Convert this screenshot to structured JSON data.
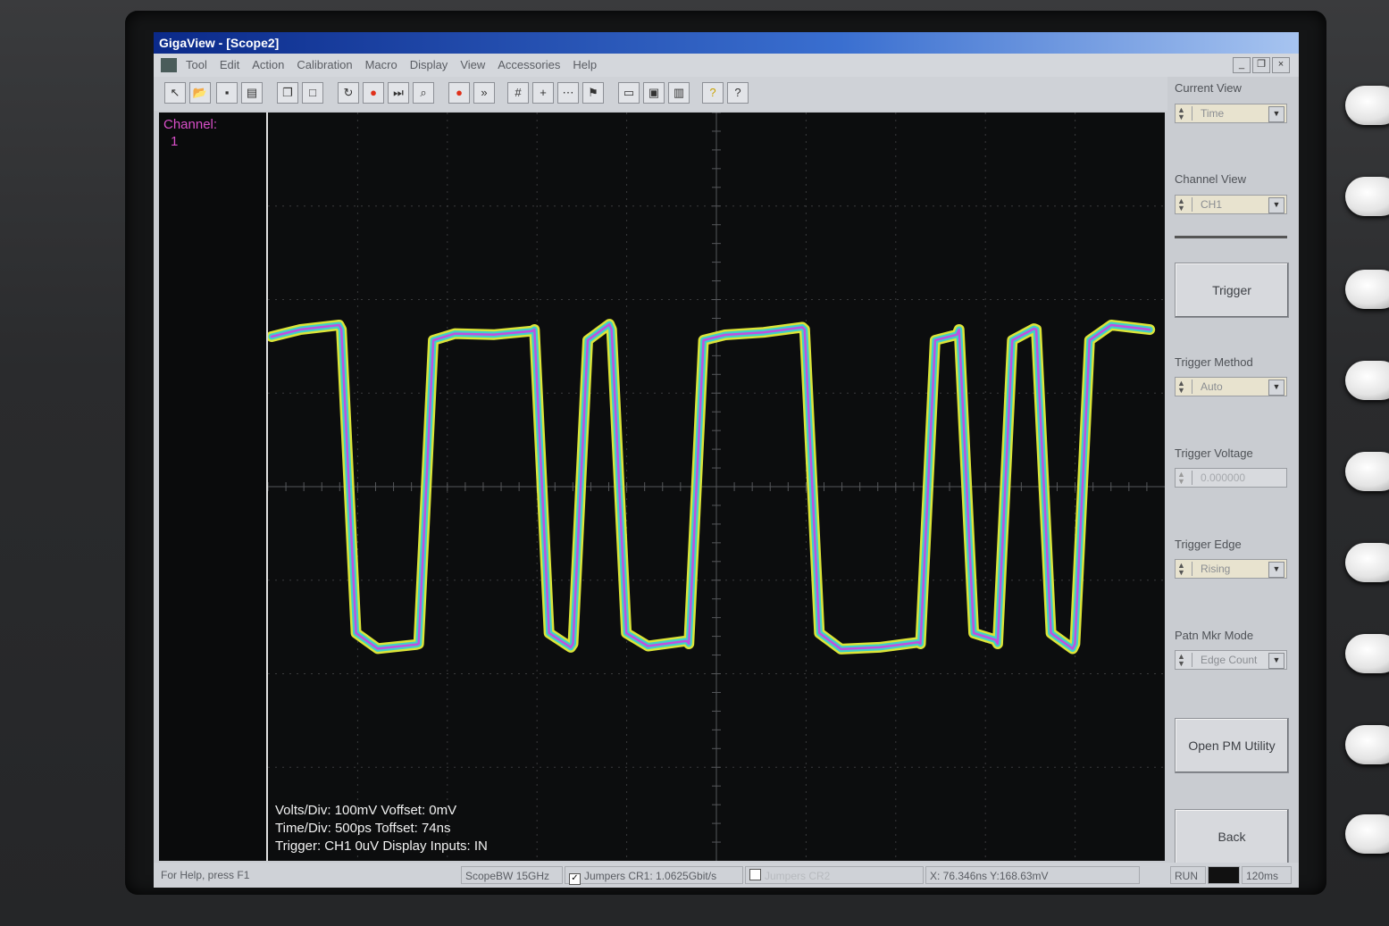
{
  "window": {
    "title": "GigaView - [Scope2]"
  },
  "menu": [
    "Tool",
    "Edit",
    "Action",
    "Calibration",
    "Macro",
    "Display",
    "View",
    "Accessories",
    "Help"
  ],
  "window_controls": [
    "_",
    "❐",
    "×"
  ],
  "toolbar_icons": [
    "pointer-icon",
    "open-icon",
    "save-icon",
    "print-icon",
    "copy-icon",
    "blank-icon",
    "cycle-icon",
    "stop-icon",
    "step-icon",
    "zoom-icon",
    "record-icon",
    "fast-forward-icon",
    "grid-icon",
    "crosshair-icon",
    "measure-icon",
    "marker-icon",
    "export-icon",
    "compare-icon",
    "report-icon",
    "help-icon",
    "context-help-icon"
  ],
  "left_panel": {
    "channel_label": "Channel:",
    "channel_number": "1"
  },
  "readout": {
    "line1": "Volts/Div: 100mV Voffset: 0mV",
    "line2": "Time/Div: 500ps Toffset: 74ns",
    "line3": "Trigger: CH1 0uV Display Inputs: IN"
  },
  "right_panel": {
    "current_view_label": "Current View",
    "current_view_value": "Time",
    "channel_view_label": "Channel View",
    "channel_view_value": "CH1",
    "trigger_button": "Trigger",
    "trigger_method_label": "Trigger Method",
    "trigger_method_value": "Auto",
    "trigger_voltage_label": "Trigger Voltage",
    "trigger_voltage_value": "0.000000",
    "trigger_edge_label": "Trigger Edge",
    "trigger_edge_value": "Rising",
    "patn_mkr_label": "Patn Mkr Mode",
    "patn_mkr_value": "Edge Count",
    "open_pm_button": "Open PM Utility",
    "back_button": "Back"
  },
  "statusbar": {
    "help": "For Help, press F1",
    "scope_bw": "ScopeBW 15GHz",
    "jumpers_cr1": "Jumpers CR1: 1.0625Gbit/s",
    "jumpers_cr2": "Jumpers CR2",
    "cursor": "X: 76.346ns Y:168.63mV",
    "run": "RUN",
    "time": "120ms"
  },
  "colors": {
    "trace_outer": "#e8f03a",
    "trace_mid": "#3fd0c8",
    "trace_inner": "#c24fe0",
    "channel_label": "#d94fc9"
  },
  "waveform": {
    "bits": [
      1,
      1,
      0,
      0,
      1,
      1,
      1,
      0,
      1,
      0,
      0,
      1,
      1,
      1,
      0,
      0,
      0,
      1,
      0,
      1,
      0,
      1,
      1
    ],
    "high_mV": 168,
    "low_mV": -168
  }
}
